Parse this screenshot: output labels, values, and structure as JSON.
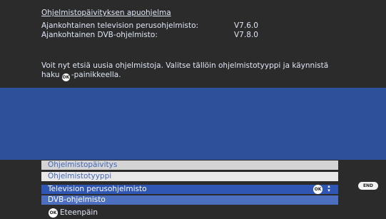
{
  "header": {
    "title": "Ohjelmistopäivityksen apuohjelma",
    "tv_label": "Ajankohtainen television perusohjelmisto:",
    "tv_version": "V7.6.0",
    "dvb_label": "Ajankohtainen DVB-ohjelmisto:",
    "dvb_version": "V7.8.0"
  },
  "info": {
    "line1": "Voit nyt etsiä uusia ohjelmistoja. Valitse tällöin ohjelmistotyyppi ja käynnistä",
    "line2_before": "haku ",
    "line2_after": "-painikkeella."
  },
  "menu": {
    "header": "Ohjelmistopäivitys",
    "type_label": "Ohjelmistotyyppi",
    "options": [
      "Television perusohjelmisto",
      "DVB-ohjelmisto"
    ]
  },
  "buttons": {
    "ok": "OK",
    "end": "END",
    "forward": "Eteenpäin"
  },
  "icons": {
    "arrows": "up-down-arrows-icon"
  }
}
